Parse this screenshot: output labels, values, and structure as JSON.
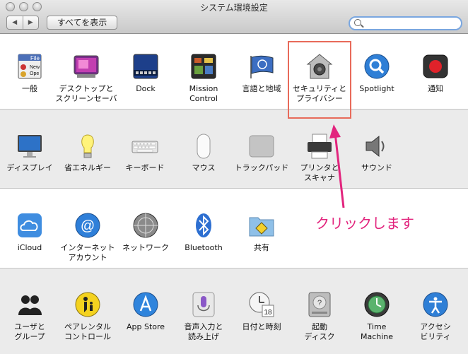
{
  "window": {
    "title": "システム環境設定",
    "show_all_label": "すべてを表示",
    "back_glyph": "◀",
    "forward_glyph": "▶",
    "search_placeholder": ""
  },
  "rows": [
    [
      "一般",
      "デスクトップと\nスクリーンセーバ",
      "Dock",
      "Mission\nControl",
      "言語と地域",
      "セキュリティと\nプライバシー",
      "Spotlight",
      "通知"
    ],
    [
      "ディスプレイ",
      "省エネルギー",
      "キーボード",
      "マウス",
      "トラックパッド",
      "プリンタと\nスキャナ",
      "サウンド"
    ],
    [
      "iCloud",
      "インターネット\nアカウント",
      "ネットワーク",
      "Bluetooth",
      "共有"
    ],
    [
      "ユーザと\nグループ",
      "ペアレンタル\nコントロール",
      "App Store",
      "音声入力と\n読み上げ",
      "日付と時刻",
      "起動\nディスク",
      "Time\nMachine",
      "アクセシ\nビリティ"
    ]
  ],
  "annotation": {
    "callout": "クリックします",
    "callout_color": "#e2247d",
    "highlight_color": "#e86a5a"
  },
  "icons": {
    "general": "general-icon",
    "date_day": "18"
  }
}
